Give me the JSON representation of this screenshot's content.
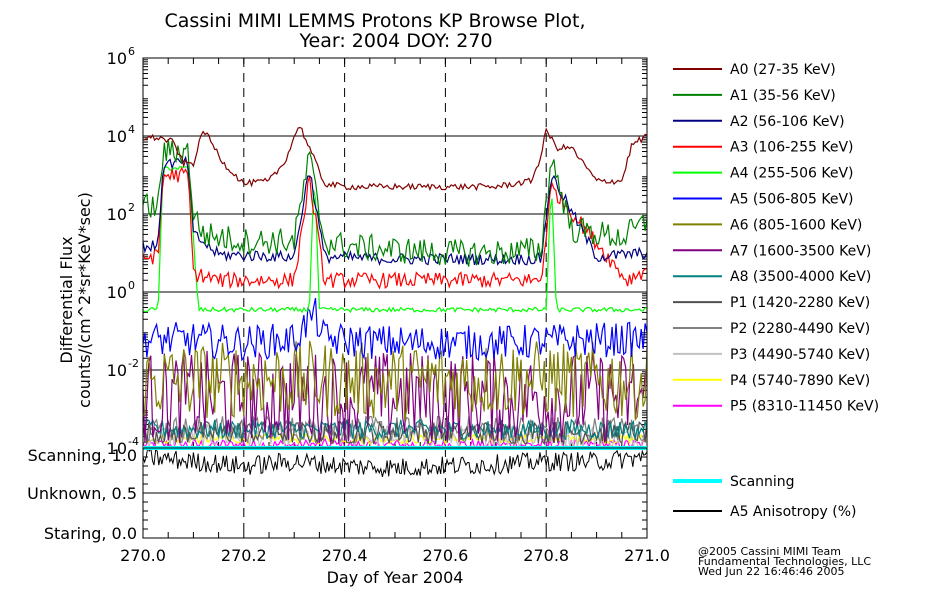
{
  "chart_data": {
    "type": "line",
    "title": "Cassini MIMI LEMMS Protons KP Browse Plot,",
    "subtitle": "Year: 2004 DOY: 270",
    "xlabel": "Day of Year 2004",
    "ylabel": "Differential Flux",
    "ylabel_units": "counts/(cm^2*sr*KeV*sec)",
    "xlim": [
      270.0,
      271.0
    ],
    "x_ticks": [
      "270.0",
      "270.2",
      "270.4",
      "270.6",
      "270.8",
      "271.0"
    ],
    "y_scale": "log",
    "ylim": [
      0.0001,
      1000000
    ],
    "y_tick_exponents": [
      "6",
      "4",
      "2",
      "0",
      "-2",
      "-4"
    ],
    "lower_panel_labels": [
      "Scanning, 1.0",
      "Unknown, 0.5",
      "Staring, 0.0"
    ],
    "lower_panel_ylim": [
      0.0,
      1.0
    ],
    "legend_position": "right",
    "series": [
      {
        "name": "A0 (27-35 KeV)",
        "color": "#800000",
        "x": [
          270.0,
          270.03,
          270.06,
          270.08,
          270.1,
          270.12,
          270.16,
          270.2,
          270.25,
          270.28,
          270.31,
          270.33,
          270.36,
          270.4,
          270.5,
          270.6,
          270.7,
          270.77,
          270.79,
          270.8,
          270.82,
          270.85,
          270.9,
          270.95,
          270.97,
          271.0
        ],
        "y": [
          9000,
          9000,
          7000,
          2000,
          2000,
          15000,
          2000,
          600,
          700,
          2000,
          20000,
          5000,
          600,
          500,
          500,
          500,
          500,
          700,
          3000,
          15000,
          5000,
          5000,
          700,
          700,
          6000,
          10000
        ]
      },
      {
        "name": "A1 (35-56 KeV)",
        "color": "#008000",
        "x": [
          270.0,
          270.03,
          270.04,
          270.09,
          270.1,
          270.12,
          270.2,
          270.3,
          270.33,
          270.36,
          270.4,
          270.5,
          270.6,
          270.7,
          270.79,
          270.81,
          270.85,
          270.95,
          271.0
        ],
        "y": [
          150,
          150,
          4000,
          4000,
          100,
          30,
          20,
          20,
          3000,
          20,
          15,
          12,
          10,
          10,
          12,
          3000,
          40,
          25,
          60
        ]
      },
      {
        "name": "A2 (56-106 KeV)",
        "color": "#000080",
        "x": [
          270.0,
          270.03,
          270.04,
          270.09,
          270.1,
          270.15,
          270.3,
          270.33,
          270.36,
          270.5,
          270.79,
          270.81,
          270.9,
          271.0
        ],
        "y": [
          15,
          15,
          2000,
          2000,
          30,
          9,
          8,
          1500,
          8,
          7,
          7,
          1000,
          8,
          10
        ]
      },
      {
        "name": "A3 (106-255 KeV)",
        "color": "#ff0000",
        "x": [
          270.0,
          270.03,
          270.04,
          270.09,
          270.1,
          270.15,
          270.3,
          270.33,
          270.36,
          270.5,
          270.79,
          270.81,
          270.96,
          271.0
        ],
        "y": [
          8,
          8,
          1000,
          1000,
          3,
          2,
          2,
          800,
          2,
          2,
          2,
          500,
          2,
          4
        ]
      },
      {
        "name": "A4 (255-506 KeV)",
        "color": "#00ff00",
        "x": [
          270.0,
          270.03,
          270.04,
          270.09,
          270.11,
          270.15,
          270.33,
          270.34,
          270.35,
          270.5,
          270.8,
          270.81,
          270.82,
          270.98,
          271.0
        ],
        "y": [
          0.35,
          0.35,
          1500,
          1500,
          0.35,
          0.35,
          0.35,
          1500,
          0.35,
          0.35,
          0.35,
          800,
          0.35,
          0.35,
          0.35
        ]
      },
      {
        "name": "A5 (506-805 KeV)",
        "color": "#0000ff",
        "x": [
          270.0,
          270.1,
          270.2,
          270.3,
          270.34,
          270.36,
          270.5,
          270.7,
          270.9,
          271.0
        ],
        "y": [
          0.06,
          0.06,
          0.05,
          0.06,
          0.3,
          0.06,
          0.05,
          0.05,
          0.06,
          0.06
        ]
      },
      {
        "name": "A6 (805-1600 KeV)",
        "color": "#808000",
        "x": [
          270.0,
          270.25,
          270.5,
          270.75,
          271.0
        ],
        "y": [
          0.005,
          0.006,
          0.005,
          0.006,
          0.005
        ]
      },
      {
        "name": "A7 (1600-3500 KeV)",
        "color": "#800080",
        "x": [
          270.0,
          270.25,
          270.5,
          270.75,
          271.0
        ],
        "y": [
          0.002,
          0.002,
          0.002,
          0.002,
          0.002
        ]
      },
      {
        "name": "A8 (3500-4000 KeV)",
        "color": "#008080",
        "x": [
          270.0,
          271.0
        ],
        "y": [
          0.0003,
          0.0003
        ]
      },
      {
        "name": "P1 (1420-2280 KeV)",
        "color": "#505050",
        "x": [
          270.0,
          271.0
        ],
        "y": [
          0.00025,
          0.00025
        ]
      },
      {
        "name": "P2 (2280-4490 KeV)",
        "color": "#808080",
        "x": [
          270.0,
          271.0
        ],
        "y": [
          0.0003,
          0.0003
        ]
      },
      {
        "name": "P3 (4490-5740 KeV)",
        "color": "#c0c0c0",
        "x": [
          270.0,
          271.0
        ],
        "y": [
          0.0002,
          0.0002
        ]
      },
      {
        "name": "P4 (5740-7890 KeV)",
        "color": "#ffff00",
        "x": [
          270.0,
          271.0
        ],
        "y": [
          0.00017,
          0.00017
        ]
      },
      {
        "name": "P5 (8310-11450 KeV)",
        "color": "#ff00ff",
        "x": [
          270.0,
          271.0
        ],
        "y": [
          0.00012,
          0.00012
        ]
      }
    ],
    "lower_series": [
      {
        "name": "Scanning",
        "color": "#00ffff",
        "x": [
          270.0,
          271.0
        ],
        "y": [
          1.0,
          1.0
        ]
      },
      {
        "name": "A5 Anisotropy (%)",
        "color": "#000000",
        "x": [
          270.0,
          270.1,
          270.2,
          270.3,
          270.4,
          270.5,
          270.6,
          270.7,
          270.8,
          270.9,
          271.0
        ],
        "y": [
          0.9,
          0.85,
          0.8,
          0.85,
          0.8,
          0.78,
          0.8,
          0.82,
          0.85,
          0.85,
          0.9
        ]
      }
    ]
  },
  "footer": {
    "line1": "@2005 Cassini MIMI Team",
    "line2": "Fundamental Technologies, LLC",
    "line3": "Wed Jun 22 16:46:46 2005"
  }
}
